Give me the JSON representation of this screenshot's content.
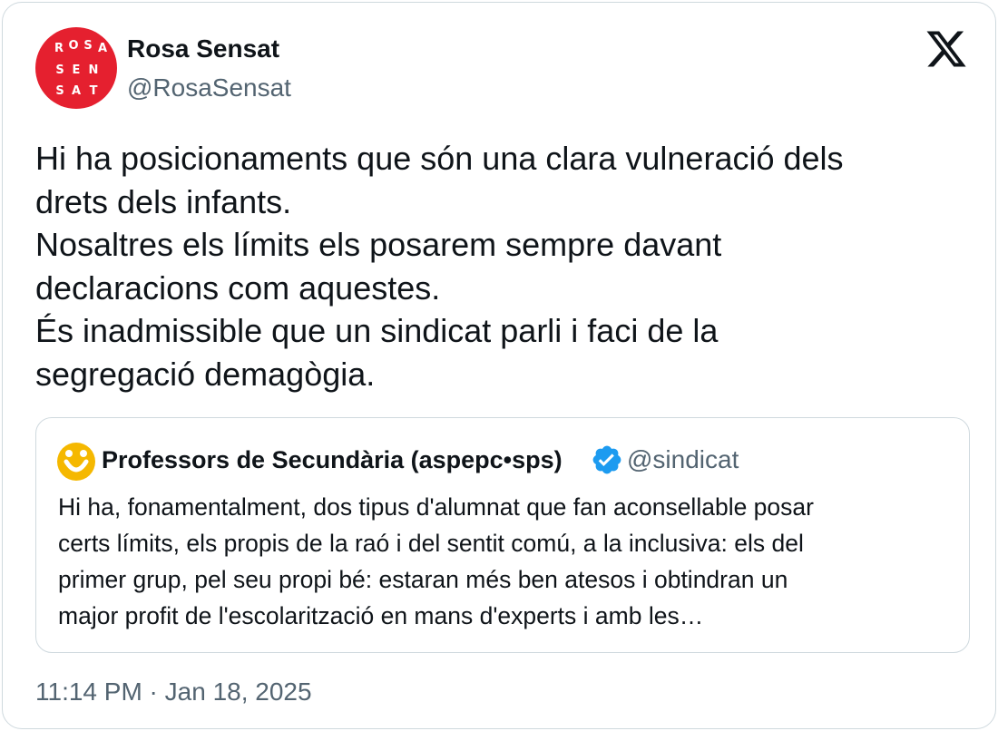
{
  "author": {
    "name": "Rosa Sensat",
    "handle": "@RosaSensat",
    "avatar_letters": [
      "R",
      "O",
      "S",
      "A",
      "S",
      "E",
      "N",
      "S",
      "A",
      "T"
    ]
  },
  "tweet": {
    "lines": [
      "Hi ha posicionaments que són una clara vulneració dels",
      "drets dels infants.",
      "Nosaltres els límits els posarem sempre davant",
      "declaracions com aquestes.",
      "És inadmissible que un sindicat parli i faci de la",
      "segregació demagògia."
    ]
  },
  "quoted": {
    "name": "Professors de Secundària (aspepc•sps)",
    "handle": "@sindicat",
    "verified": true,
    "lines": [
      "Hi ha, fonamentalment, dos tipus d'alumnat que fan aconsellable posar",
      "certs límits, els propis de la raó i del sentit comú, a la inclusiva: els del",
      "primer grup, pel seu propi bé: estaran més ben atesos i obtindran un",
      "major profit de l'escolarització en mans d'experts i amb les…"
    ]
  },
  "timestamp": "11:14 PM · Jan 18, 2025",
  "colors": {
    "avatar_red": "#e5202f",
    "verified_blue": "#1d9bf0",
    "quote_avatar_yellow": "#f5b800",
    "secondary_text": "#536471",
    "border": "#cfd9de"
  },
  "icons": {
    "brand": "x-logo-icon",
    "verified": "verified-badge-icon"
  }
}
